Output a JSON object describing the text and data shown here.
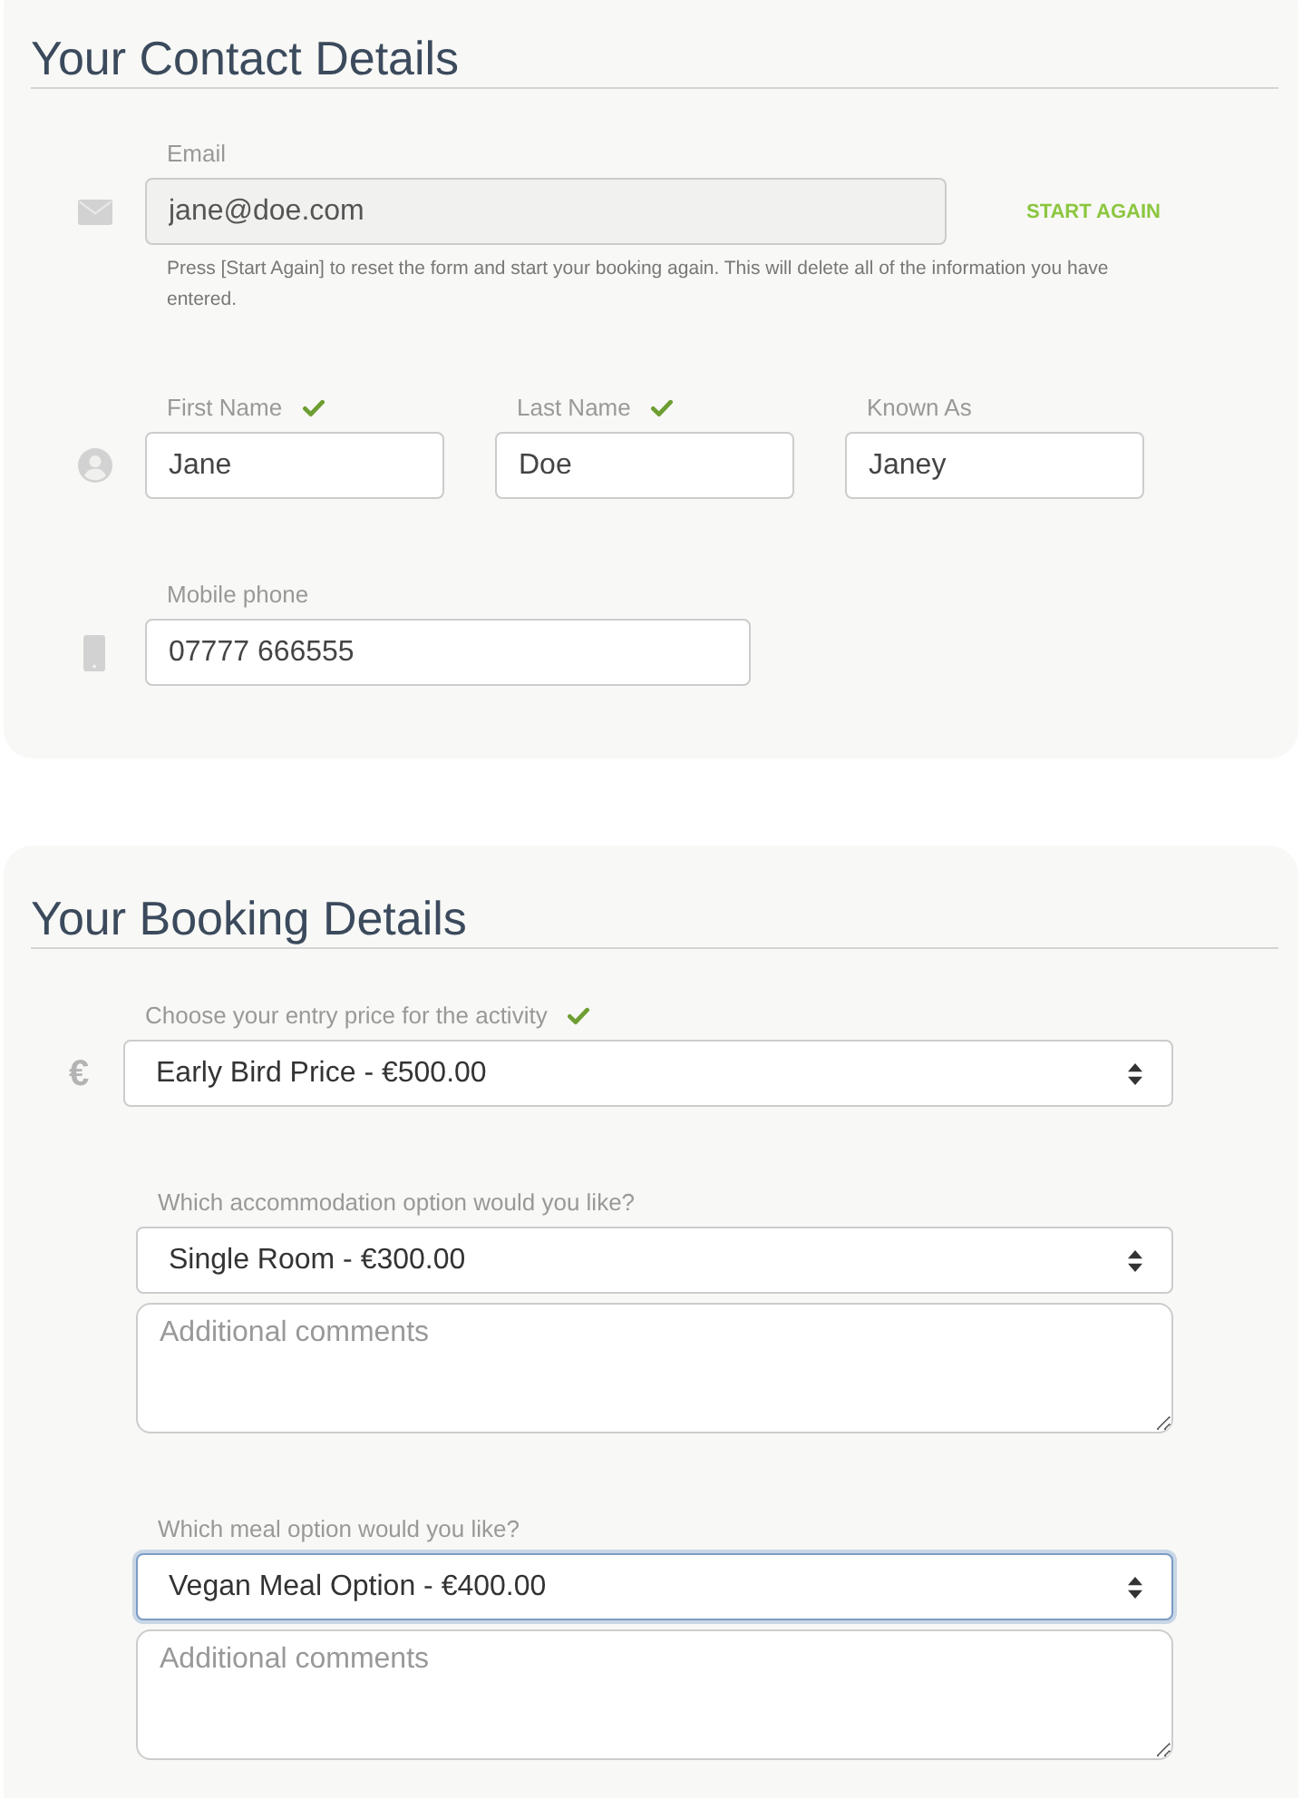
{
  "contact": {
    "title": "Your Contact Details",
    "email": {
      "label": "Email",
      "value": "jane@doe.com",
      "disabled": true,
      "action": "START AGAIN",
      "help": "Press [Start Again] to reset the form and start your booking again. This will delete all of the information you have entered."
    },
    "name_fields": [
      {
        "label": "First Name",
        "value": "Jane",
        "valid": true
      },
      {
        "label": "Last Name",
        "value": "Doe",
        "valid": true
      },
      {
        "label": "Known As",
        "value": "Janey",
        "valid": false
      }
    ],
    "phone": {
      "label": "Mobile phone",
      "value": "07777 666555"
    }
  },
  "booking": {
    "title": "Your Booking Details",
    "options": [
      {
        "label": "Choose your entry price for the activity",
        "symbol": "€",
        "value": "Early Bird Price - €500.00",
        "valid": true,
        "focused": false
      },
      {
        "label": "Which accommodation option would you like?",
        "value": "Single Room - €300.00",
        "valid": false,
        "focused": false,
        "comments": {
          "placeholder": "Additional comments"
        }
      },
      {
        "label": "Which meal option would you like?",
        "value": "Vegan Meal Option - €400.00",
        "valid": false,
        "focused": true,
        "comments": {
          "placeholder": "Additional comments"
        }
      }
    ]
  }
}
